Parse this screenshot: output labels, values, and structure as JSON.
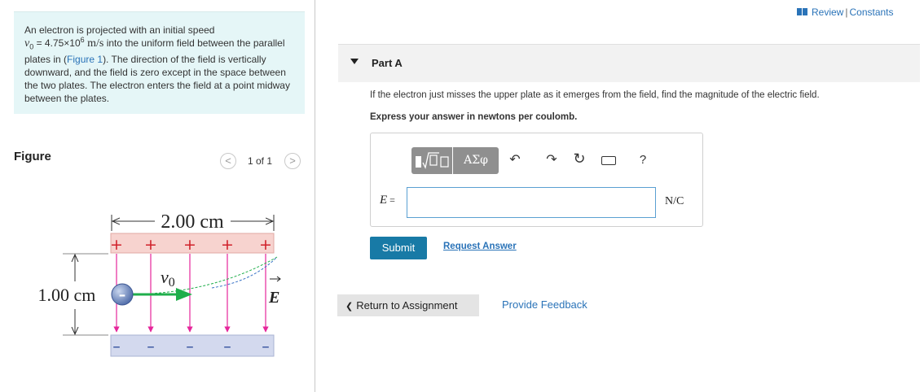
{
  "problem": {
    "text_1": "An electron is projected with an initial speed",
    "v0_symbol": "v",
    "v0_sub": "0",
    "v0_eq": " = 4.75×10",
    "v0_exp": "6",
    "v0_unit": " m/s",
    "text_2": " into the uniform field between the parallel plates in (",
    "figure_link": "Figure 1",
    "text_3": "). The direction of the field is vertically downward, and the field is zero except in the space between the two plates. The electron enters the field at a point midway between the plates."
  },
  "figure": {
    "label": "Figure",
    "counter": "1 of 1",
    "prev": "<",
    "next": ">",
    "width_label": "2.00 cm",
    "height_label": "1.00 cm",
    "velocity_label": "v",
    "velocity_sub": "0",
    "field_label": "E",
    "plus_signs": [
      "+",
      "+",
      "+",
      "+",
      "+"
    ],
    "minus_signs": [
      "–",
      "–",
      "–",
      "–",
      "–"
    ],
    "electron_sign": "–"
  },
  "header": {
    "review": "Review",
    "separator": "|",
    "constants": "Constants"
  },
  "part_a": {
    "title": "Part A",
    "question": "If the electron just misses the upper plate as it emerges from the field, find the magnitude of the electric field.",
    "instruction": "Express your answer in newtons per coulomb.",
    "toolbar": {
      "greek": "ΑΣφ",
      "undo": "↶",
      "redo": "↷",
      "reset": "↻",
      "help": "?"
    },
    "eq_var": "E",
    "eq_sign": " =",
    "input_value": "",
    "unit": "N/C",
    "submit": "Submit",
    "request_answer": "Request Answer"
  },
  "footer": {
    "return": "Return to Assignment",
    "return_chevron": "❮",
    "feedback": "Provide Feedback"
  },
  "colors": {
    "accent": "#187aa6",
    "link": "#2a73b8",
    "problem_bg": "#e5f6f7",
    "positive_plate": "#f7d3cf",
    "negative_plate": "#d3d9ee",
    "field_lines": "#e6269b",
    "velocity_arrow": "#1fae4b"
  }
}
